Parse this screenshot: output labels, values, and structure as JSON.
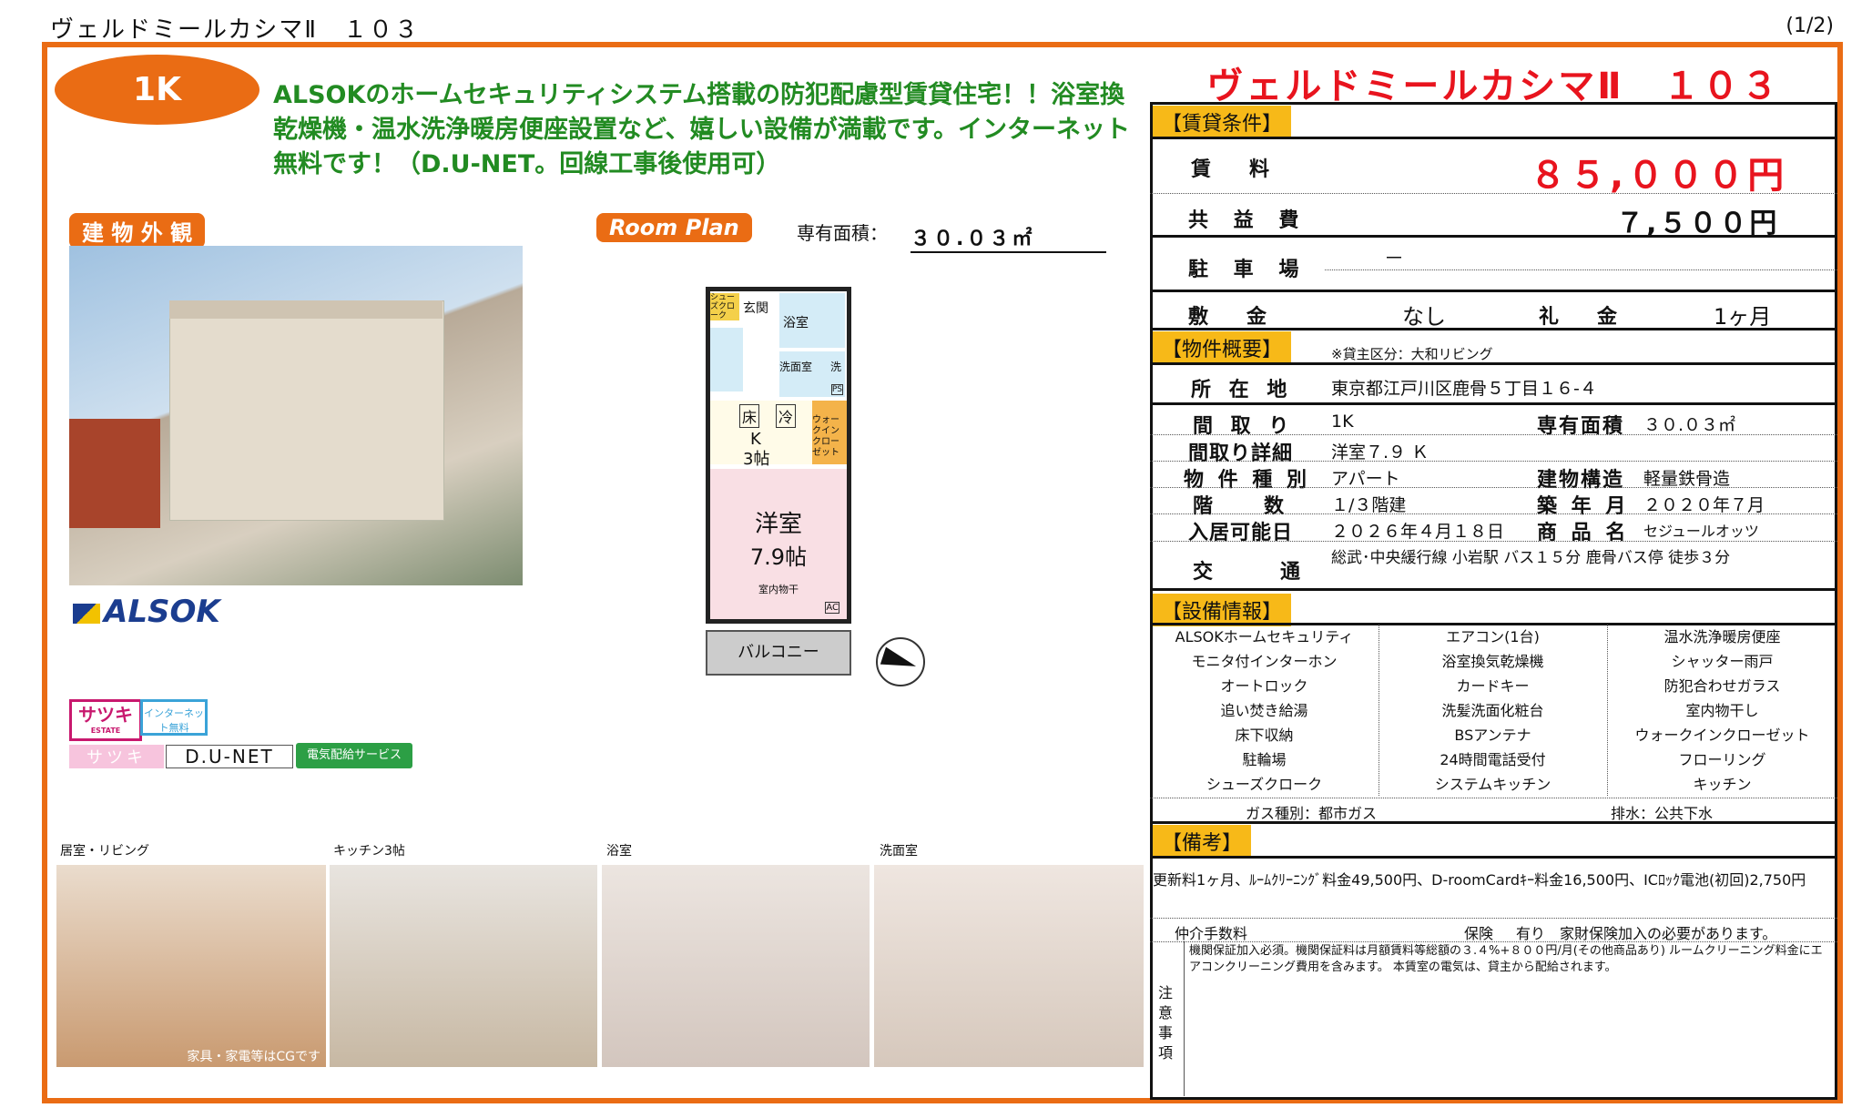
{
  "header": {
    "name": "ヴェルドミールカシマⅡ　１０３",
    "page": "(1/2)"
  },
  "layout_badge": "1K",
  "catchcopy": "ALSOKのホームセキュリティシステム搭載の防犯配慮型賃貸住宅！！浴室換乾燥機・温水洗浄暖房便座設置など、嬉しい設備が満載です。インターネット無料です！（D.U-NET。回線工事後使用可）",
  "exterior_label": "建 物 外 観",
  "roomplan_label": "Room Plan",
  "area_label": "専有面積：",
  "area_value": "３０.０３㎡",
  "alsok_logo": "ALSOK",
  "floorplan": {
    "shoes": "シューズクローク",
    "genkan": "玄関",
    "bath": "浴室",
    "washroom": "洗面室",
    "wash": "洗",
    "ps": "PS",
    "floor": "床",
    "fridge": "冷",
    "k": "K",
    "k_size": "3帖",
    "closet": "ウォークインクローゼット",
    "room": "洋室",
    "room_size": "7.9帖",
    "indoor_dry": "室内物干",
    "ac": "AC",
    "balcony": "バルコニー"
  },
  "badges": {
    "satsuki": "サツキ",
    "satsuki_sub": "ESTATE",
    "internet": "インターネット無料",
    "satsuki2": "サツキ",
    "dunet": "D.U-NET",
    "power": "電気配給サービス"
  },
  "photos": [
    {
      "caption": "居室・リビング",
      "note": "家具・家電等はCGです"
    },
    {
      "caption": "キッチン3帖",
      "note": ""
    },
    {
      "caption": "浴室",
      "note": ""
    },
    {
      "caption": "洗面室",
      "note": ""
    }
  ],
  "title": "ヴェルドミールカシマⅡ　１０３",
  "rent_section": {
    "head": "【賃貸条件】",
    "rent_label": "賃　料",
    "rent": "８５,０００円",
    "common_label": "共 益 費",
    "common": "７,５００円",
    "parking_label": "駐 車 場",
    "parking": "－",
    "deposit_label": "敷　金",
    "deposit": "なし",
    "key_label": "礼　金",
    "key": "1ヶ月"
  },
  "overview": {
    "head": "【物件概要】",
    "note": "※貸主区分：大和リビング",
    "address_label": "所 在 地",
    "address": "東京都江戸川区鹿骨５丁目１６-４",
    "layout_label": "間 取 り",
    "layout": "1K",
    "area_label": "専有面積",
    "area": "３０.０３㎡",
    "detail_label": "間取り詳細",
    "detail": "洋室７.９ Ｋ",
    "type_label": "物 件 種 別",
    "type": "アパート",
    "structure_label": "建物構造",
    "structure": "軽量鉄骨造",
    "floor_label": "階　　数",
    "floor": "１/３階建",
    "built_label": "築 年 月",
    "built": "２０２０年７月",
    "move_label": "入居可能日",
    "move": "２０２６年４月１８日",
    "product_label": "商 品 名",
    "product": "セジュールオッツ",
    "access_label": "交　　通",
    "access": "総武･中央緩行線 小岩駅 バス１５分 鹿骨バス停 徒歩３分"
  },
  "equipment": {
    "head": "【設備情報】",
    "items": [
      "ALSOKホームセキュリティ",
      "エアコン(1台)",
      "温水洗浄暖房便座",
      "モニタ付インターホン",
      "浴室換気乾燥機",
      "シャッター雨戸",
      "オートロック",
      "カードキー",
      "防犯合わせガラス",
      "追い焚き給湯",
      "洗髪洗面化粧台",
      "室内物干し",
      "床下収納",
      "BSアンテナ",
      "ウォークインクローゼット",
      "駐輪場",
      "24時間電話受付",
      "フローリング",
      "シューズクローク",
      "システムキッチン",
      "キッチン"
    ],
    "gas": "ガス種別：都市ガス",
    "drain": "排水：公共下水"
  },
  "remarks": {
    "head": "【備考】",
    "fees": "更新料1ヶ月、ﾙｰﾑｸﾘｰﾆﾝｸﾞ料金49,500円、D-roomCardｷｰ料金16,500円、ICﾛｯｸ電池(初回)2,750円",
    "broker_label": "仲介手数料",
    "insurance_label": "保険",
    "insurance": "有り　家財保険加入の必要があります。",
    "notes_label": "注意事項",
    "notes": "機関保証加入必須。機関保証料は月額賃料等総額の３.４%+８００円/月(その他商品あり) ルームクリーニング料金にエアコンクリーニング費用を含みます。 本賃室の電気は、貸主から配給されます。"
  }
}
